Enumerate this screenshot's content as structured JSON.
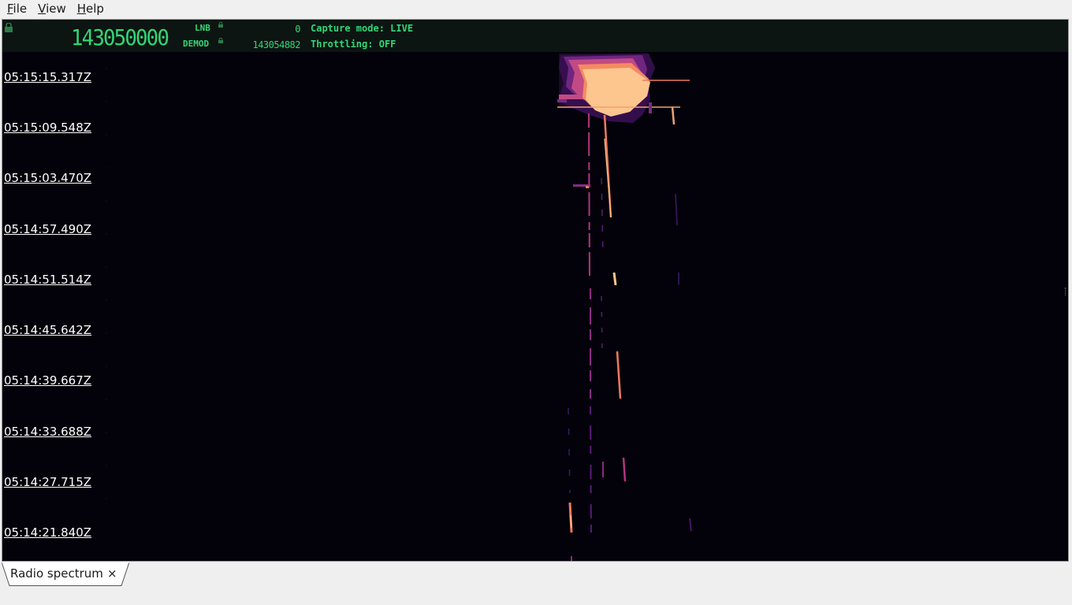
{
  "menubar": {
    "file": {
      "accel": "F",
      "rest": "ile"
    },
    "view": {
      "accel": "V",
      "rest": "iew"
    },
    "help": {
      "accel": "H",
      "rest": "elp"
    }
  },
  "status": {
    "main_frequency": "143050000",
    "lnb_label": "LNB",
    "lnb_value": "0",
    "demod_label": "DEMOD",
    "demod_value": "143054882",
    "capture_mode": "Capture mode: LIVE",
    "throttling": "Throttling: OFF",
    "accent_color": "#33d676"
  },
  "waterfall": {
    "timestamps": [
      "05:15:15.317Z",
      "05:15:09.548Z",
      "05:15:03.470Z",
      "05:14:57.490Z",
      "05:14:51.514Z",
      "05:14:45.642Z",
      "05:14:39.667Z",
      "05:14:33.688Z",
      "05:14:27.715Z",
      "05:14:21.840Z"
    ],
    "background_color": "#03020a",
    "signal_colors": [
      "#5a1a78",
      "#b2347f",
      "#f07a5e",
      "#fdc68f"
    ]
  },
  "tabs": [
    {
      "label": "Radio spectrum",
      "close": "×"
    }
  ]
}
